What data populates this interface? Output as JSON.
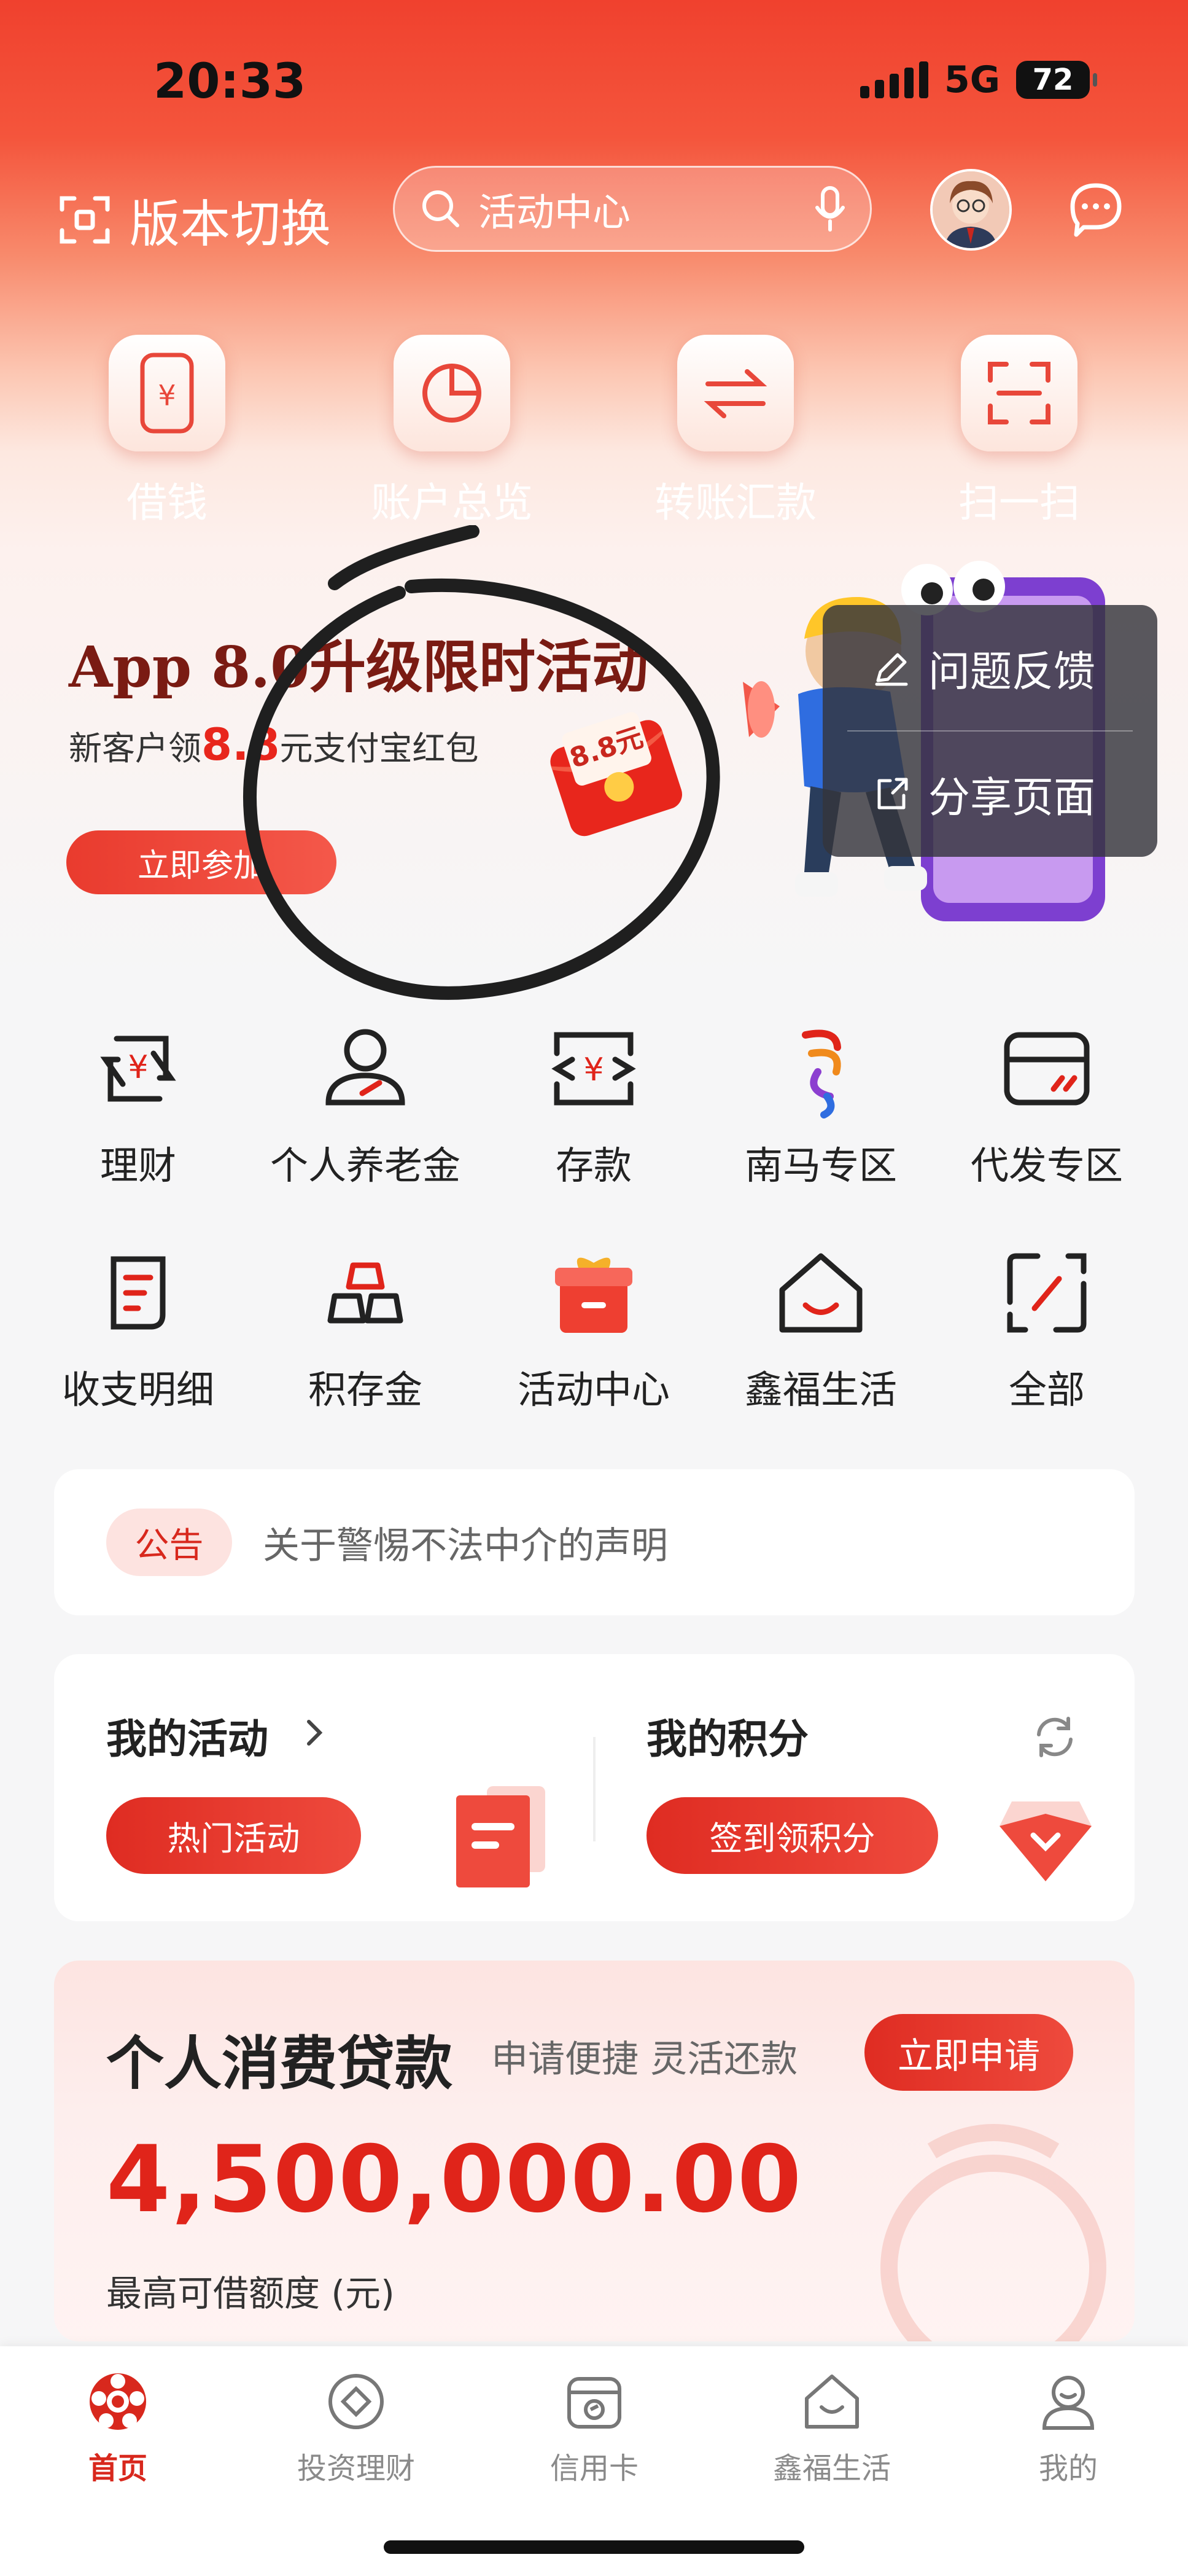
{
  "status_bar": {
    "time": "20:33",
    "network": "5G",
    "battery": "72"
  },
  "header": {
    "switch_label": "版本切换",
    "search_placeholder": "活动中心"
  },
  "quick_actions": [
    {
      "label": "借钱",
      "icon": "loan-phone-icon"
    },
    {
      "label": "账户总览",
      "icon": "pie-chart-icon"
    },
    {
      "label": "转账汇款",
      "icon": "transfer-arrows-icon"
    },
    {
      "label": "扫一扫",
      "icon": "scan-icon"
    }
  ],
  "banner": {
    "title": "App 8.0升级限时活动",
    "subtitle_prefix": "新客户领",
    "subtitle_amount": "8.8",
    "subtitle_suffix": "元支付宝红包",
    "button": "立即参加",
    "redpack_text": "8.8元"
  },
  "popup_menu": [
    {
      "label": "问题反馈",
      "icon": "edit-icon"
    },
    {
      "label": "分享页面",
      "icon": "share-icon"
    }
  ],
  "service_grid": [
    {
      "label": "理财",
      "icon": "wealth-icon"
    },
    {
      "label": "个人养老金",
      "icon": "pension-icon"
    },
    {
      "label": "存款",
      "icon": "deposit-icon"
    },
    {
      "label": "南马专区",
      "icon": "marathon-icon"
    },
    {
      "label": "代发专区",
      "icon": "payroll-card-icon"
    },
    {
      "label": "收支明细",
      "icon": "statement-icon"
    },
    {
      "label": "积存金",
      "icon": "gold-bars-icon"
    },
    {
      "label": "活动中心",
      "icon": "gift-box-icon"
    },
    {
      "label": "鑫福生活",
      "icon": "home-smile-icon"
    },
    {
      "label": "全部",
      "icon": "all-services-icon"
    }
  ],
  "notice": {
    "badge": "公告",
    "text": "关于警惕不法中介的声明"
  },
  "activities": {
    "title": "我的活动",
    "button": "热门活动"
  },
  "points": {
    "title": "我的积分",
    "button": "签到领积分"
  },
  "loan": {
    "title": "个人消费贷款",
    "subtitle": "申请便捷 灵活还款",
    "button": "立即申请",
    "amount": "4,500,000.00",
    "note": "最高可借额度 (元)"
  },
  "tabbar": [
    {
      "label": "首页",
      "active": true
    },
    {
      "label": "投资理财",
      "active": false
    },
    {
      "label": "信用卡",
      "active": false
    },
    {
      "label": "鑫福生活",
      "active": false
    },
    {
      "label": "我的",
      "active": false
    }
  ],
  "colors": {
    "brand_red": "#e0241a",
    "header_red": "#f0412e",
    "popup_bg": "#34343c"
  }
}
